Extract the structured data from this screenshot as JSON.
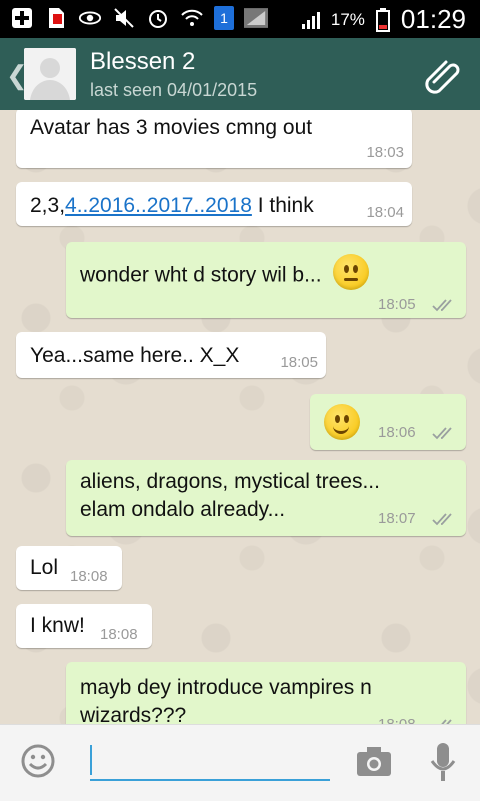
{
  "status_bar": {
    "sim_number": "1",
    "battery": "17%",
    "time": "01:29"
  },
  "header": {
    "back": "❮",
    "contact_name": "Blessen 2",
    "last_seen": "last seen 04/01/2015"
  },
  "messages": [
    {
      "dir": "in",
      "text": "Avatar has 3 movies cmng out",
      "time": "18:03"
    },
    {
      "dir": "in",
      "text_prefix": "2,3,",
      "link": "4..2016..2017..2018",
      "text_suffix": " I think",
      "time": "18:04"
    },
    {
      "dir": "out",
      "text": "wonder wht d story wil b...",
      "emoji": "neutral-face",
      "time": "18:05"
    },
    {
      "dir": "in",
      "text": "Yea...same here.. X_X",
      "time": "18:05"
    },
    {
      "dir": "out",
      "emoji": "smiling-face",
      "time": "18:06"
    },
    {
      "dir": "out",
      "line1": "aliens, dragons, mystical trees...",
      "line2": "elam ondalo already...",
      "time": "18:07"
    },
    {
      "dir": "in",
      "text": "Lol",
      "time": "18:08"
    },
    {
      "dir": "in",
      "text": "I knw!",
      "time": "18:08"
    },
    {
      "dir": "out",
      "line1": "mayb dey introduce vampires n",
      "line2": "wizards???",
      "time": "18:08"
    }
  ],
  "colors": {
    "header_bg": "#2f5e57",
    "incoming_bubble": "#ffffff",
    "outgoing_bubble": "#e2f7cb",
    "chat_bg": "#e5ddd0",
    "input_accent": "#3aa0d8"
  }
}
